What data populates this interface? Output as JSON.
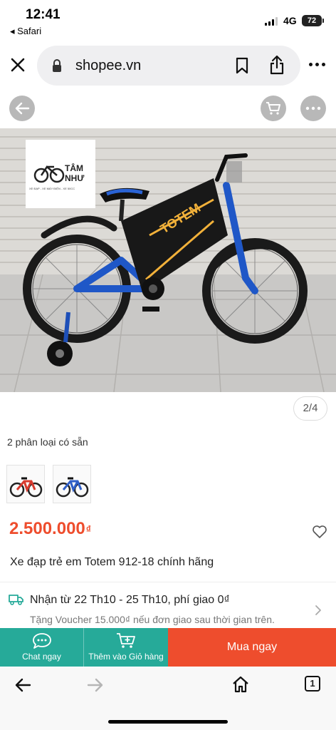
{
  "status_bar": {
    "time": "12:41",
    "back_app": "◂ Safari",
    "network": "4G",
    "battery": "72"
  },
  "browser": {
    "url": "shopee.vn"
  },
  "gallery": {
    "counter": "2/4",
    "logo_line1": "TÂM",
    "logo_line2": "NHƯ",
    "logo_tagline": "XE ĐẠP - XE MÁY ĐIỆN - XE 50CC",
    "frame_text": "TOTEM"
  },
  "variants": {
    "label": "2 phân loại có sẵn",
    "colors": [
      "#d83a2e",
      "#2f5fc8"
    ]
  },
  "product": {
    "price": "2.500.000",
    "currency": "₫",
    "title": "Xe đạp trẻ em Totem 912-18 chính hãng"
  },
  "shipping": {
    "main": "Nhận từ 22 Th10 - 25 Th10, phí giao 0₫",
    "sub": "Tặng Voucher 15.000₫ nếu đơn giao sau thời gian trên."
  },
  "actions": {
    "chat": "Chat ngay",
    "add_to_cart": "Thêm vào Giỏ hàng",
    "buy": "Mua ngay"
  },
  "toolbar": {
    "tabs_count": "1"
  },
  "colors": {
    "shopee_orange": "#ee4d2d",
    "shopee_teal": "#26aa99"
  }
}
